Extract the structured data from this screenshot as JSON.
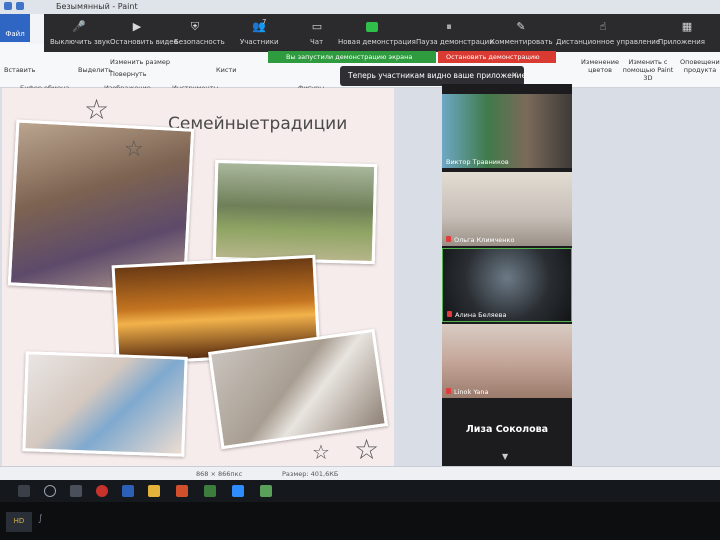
{
  "paint": {
    "title": "Безымянный - Paint",
    "file_tab": "Файл",
    "groups": [
      "Буфер обмена",
      "Изображение",
      "Инструменты",
      "Фигуры"
    ],
    "buttons": {
      "paste": "Вставить",
      "select": "Выделить",
      "resize": "Изменить размер",
      "rotate": "Повернуть",
      "brushes": "Кисти",
      "edit_colors": "Изменение цветов",
      "paint3d": "Изменить с помощью Paint 3D",
      "product_alert": "Оповещение продукта"
    },
    "status": {
      "dimensions": "868 × 866пкс",
      "size": "Размер: 401,6КБ"
    }
  },
  "zoom": {
    "toolbar": {
      "mute": "Выключить звук",
      "stop_video": "Остановить видео",
      "security": "Безопасность",
      "participants": "Участники",
      "participants_count": "7",
      "chat": "Чат",
      "new_share": "Новая демонстрация",
      "pause_share": "Пауза демонстрации",
      "annotate": "Комментировать",
      "remote_control": "Дистанционное управление",
      "apps": "Приложения"
    },
    "sharing_banner": "Вы запустили демонстрацию экрана",
    "stop_share": "Остановить демонстрацию",
    "toast": "Теперь участникам видно ваше приложение",
    "toast_close": "×",
    "participants": [
      {
        "name": "Виктор Травников",
        "muted": false
      },
      {
        "name": "Ольга Климченко",
        "muted": true
      },
      {
        "name": "Алина Беляева",
        "muted": true
      },
      {
        "name": "Linok Yana",
        "muted": true
      }
    ],
    "active_speaker": "Лиза Соколова"
  },
  "slide": {
    "title": "Семейныетрадиции"
  },
  "colors": {
    "zoom_dark": "#2b2b2e",
    "share_green": "#2d9b3e",
    "stop_red": "#d93b32",
    "paint_blue": "#2f66c4"
  }
}
